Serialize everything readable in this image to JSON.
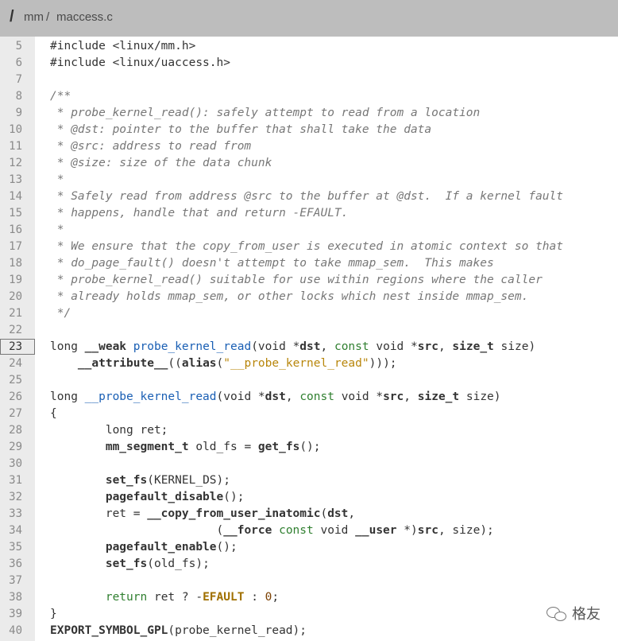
{
  "breadcrumb": {
    "slash": "/",
    "root": "mm",
    "separator": "/",
    "file": "maccess.c"
  },
  "active_line": "23",
  "lines": [
    {
      "n": "5",
      "t": "#include <linux/mm.h>"
    },
    {
      "n": "6",
      "t": "#include <linux/uaccess.h>"
    },
    {
      "n": "7",
      "t": ""
    },
    {
      "n": "8",
      "t": "/**"
    },
    {
      "n": "9",
      "t": " * probe_kernel_read(): safely attempt to read from a location"
    },
    {
      "n": "10",
      "t": " * @dst: pointer to the buffer that shall take the data"
    },
    {
      "n": "11",
      "t": " * @src: address to read from"
    },
    {
      "n": "12",
      "t": " * @size: size of the data chunk"
    },
    {
      "n": "13",
      "t": " *"
    },
    {
      "n": "14",
      "t": " * Safely read from address @src to the buffer at @dst.  If a kernel fault"
    },
    {
      "n": "15",
      "t": " * happens, handle that and return -EFAULT."
    },
    {
      "n": "16",
      "t": " *"
    },
    {
      "n": "17",
      "t": " * We ensure that the copy_from_user is executed in atomic context so that"
    },
    {
      "n": "18",
      "t": " * do_page_fault() doesn't attempt to take mmap_sem.  This makes"
    },
    {
      "n": "19",
      "t": " * probe_kernel_read() suitable for use within regions where the caller"
    },
    {
      "n": "20",
      "t": " * already holds mmap_sem, or other locks which nest inside mmap_sem."
    },
    {
      "n": "21",
      "t": " */"
    },
    {
      "n": "22",
      "t": ""
    },
    {
      "n": "23",
      "t": "long __weak probe_kernel_read(void *dst, const void *src, size_t size)"
    },
    {
      "n": "24",
      "t": "    __attribute__((alias(\"__probe_kernel_read\")));"
    },
    {
      "n": "25",
      "t": ""
    },
    {
      "n": "26",
      "t": "long __probe_kernel_read(void *dst, const void *src, size_t size)"
    },
    {
      "n": "27",
      "t": "{"
    },
    {
      "n": "28",
      "t": "        long ret;"
    },
    {
      "n": "29",
      "t": "        mm_segment_t old_fs = get_fs();"
    },
    {
      "n": "30",
      "t": ""
    },
    {
      "n": "31",
      "t": "        set_fs(KERNEL_DS);"
    },
    {
      "n": "32",
      "t": "        pagefault_disable();"
    },
    {
      "n": "33",
      "t": "        ret = __copy_from_user_inatomic(dst,"
    },
    {
      "n": "34",
      "t": "                        (__force const void __user *)src, size);"
    },
    {
      "n": "35",
      "t": "        pagefault_enable();"
    },
    {
      "n": "36",
      "t": "        set_fs(old_fs);"
    },
    {
      "n": "37",
      "t": ""
    },
    {
      "n": "38",
      "t": "        return ret ? -EFAULT : 0;"
    },
    {
      "n": "39",
      "t": "}"
    },
    {
      "n": "40",
      "t": "EXPORT_SYMBOL_GPL(probe_kernel_read);"
    }
  ],
  "watermark": {
    "text": "格友",
    "icon": "wechat-icon"
  }
}
